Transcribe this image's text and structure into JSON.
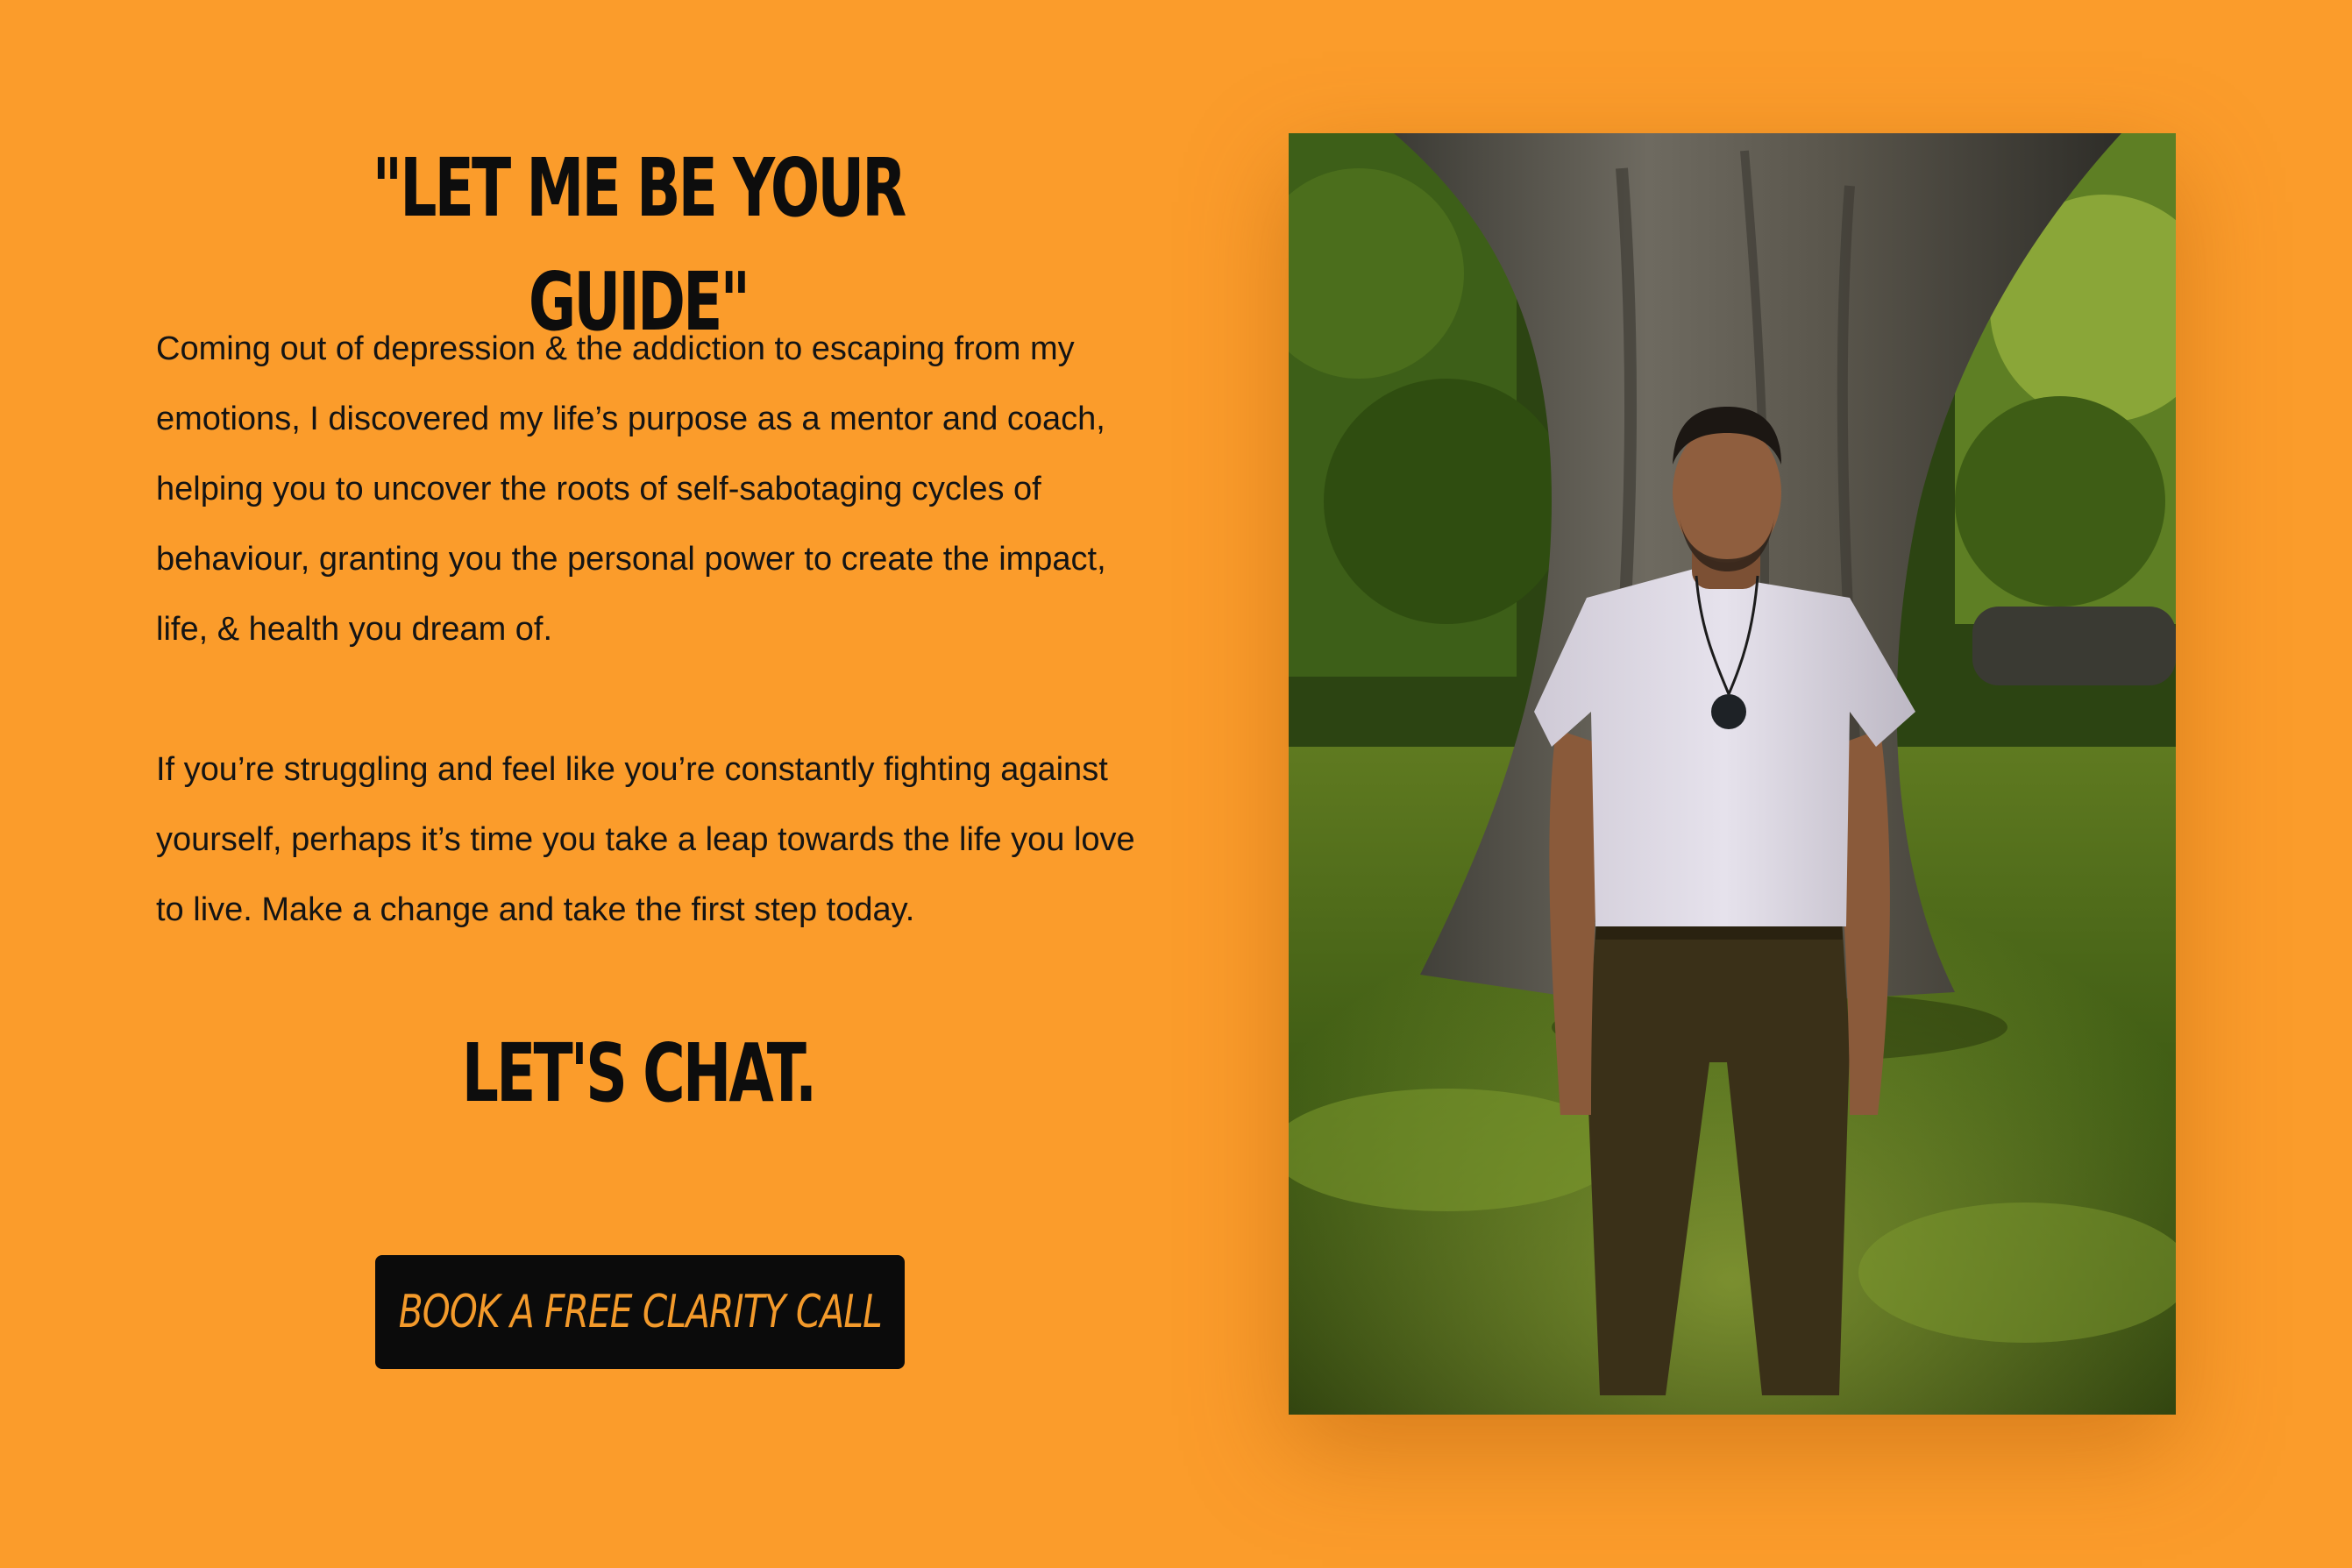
{
  "hero": {
    "headline": "\"LET ME BE YOUR GUIDE\"",
    "paragraph_1": "Coming out of depression & the addiction to escaping from my emotions, I discovered my life’s purpose as a mentor and coach, helping you to uncover the roots of self-sabotaging cycles of behaviour, granting you the personal power to create the impact, life, & health you dream of.",
    "paragraph_2": "If you’re struggling and feel like you’re constantly fighting against yourself, perhaps it’s time you take a leap towards the life you love to live. Make a change and take the first step today.",
    "cta_heading": "LET'S CHAT.",
    "cta_button_label": "BOOK A FREE CLARITY CALL"
  },
  "photo": {
    "subject": "man in white t-shirt standing in front of a large tree trunk"
  },
  "colors": {
    "background": "#fb9c2b",
    "text": "#111111",
    "button_bg": "#0b0b0b",
    "button_text": "#f39a2b"
  }
}
